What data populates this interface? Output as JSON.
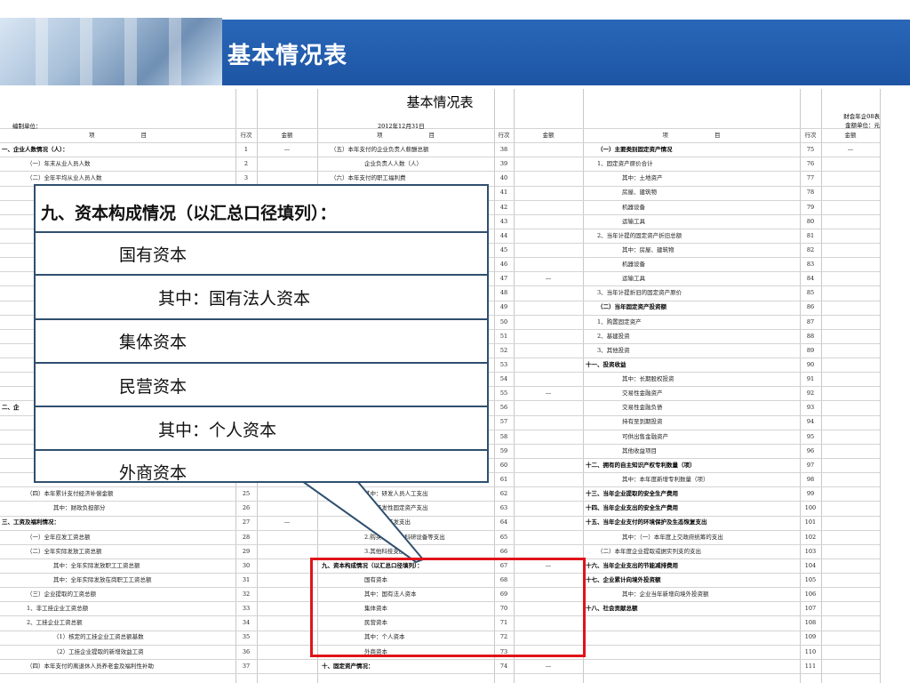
{
  "slide": {
    "title": "基本情况表"
  },
  "sheet": {
    "title": "基本情况表",
    "unit_label": "编制单位：",
    "date": "2012年12月31日",
    "form_no": "财会年企08表",
    "currency": "金额单位：元",
    "headers": [
      "项　　　　　　　　目",
      "行次",
      "金额",
      "项　　　　　　　　目",
      "行次",
      "金额",
      "项　　　　　　　　目",
      "行次",
      "金额"
    ]
  },
  "rows": [
    {
      "a": "一、企业人数情况（人）：",
      "ab": true,
      "an": "1",
      "av": "—",
      "b": "（五）本年支付的企业负责人薪酬总额",
      "bn": "38",
      "bv": "",
      "c": "（一）主要类别固定资产情况",
      "cb": true,
      "cn": "75",
      "cv": "—"
    },
    {
      "a": "（一）年末从业人员人数",
      "an": "2",
      "av": "",
      "b": "企业负责人人数（人）",
      "bn": "39",
      "bv": "",
      "c": "1、固定资产原价合计",
      "cn": "76",
      "cv": ""
    },
    {
      "a": "（二）全年平均从业人员人数",
      "an": "3",
      "av": "",
      "b": "（六）本年支付的职工福利费",
      "bn": "40",
      "bv": "",
      "c": "其中：土地资产",
      "cn": "77",
      "cv": ""
    },
    {
      "a": "（",
      "an": "",
      "av": "",
      "b": "",
      "bn": "41",
      "bv": "",
      "c": "房屋、建筑物",
      "cn": "78",
      "cv": ""
    },
    {
      "a": "",
      "an": "",
      "av": "",
      "b": "",
      "bn": "42",
      "bv": "",
      "c": "机器设备",
      "cn": "79",
      "cv": ""
    },
    {
      "a": "",
      "an": "",
      "av": "",
      "b": "",
      "bn": "43",
      "bv": "",
      "c": "运输工具",
      "cn": "80",
      "cv": ""
    },
    {
      "a": "",
      "an": "",
      "av": "",
      "b": "",
      "bn": "44",
      "bv": "",
      "c": "2、当年计提的固定资产折旧总额",
      "cn": "81",
      "cv": ""
    },
    {
      "a": "（",
      "an": "",
      "av": "",
      "b": "",
      "bn": "45",
      "bv": "",
      "c": "其中：房屋、建筑物",
      "cn": "82",
      "cv": ""
    },
    {
      "a": "（",
      "an": "",
      "av": "",
      "b": "",
      "bn": "46",
      "bv": "",
      "c": "机器设备",
      "cn": "83",
      "cv": ""
    },
    {
      "a": "（",
      "an": "",
      "av": "",
      "b": "",
      "bn": "47",
      "bv": "—",
      "c": "运输工具",
      "cn": "84",
      "cv": ""
    },
    {
      "a": "（",
      "an": "",
      "av": "",
      "b": "",
      "bn": "48",
      "bv": "",
      "c": "3、当年计提折旧的固定资产原价",
      "cn": "85",
      "cv": ""
    },
    {
      "a": "（",
      "an": "",
      "av": "",
      "b": "",
      "bn": "49",
      "bv": "",
      "c": "（二）当年固定资产投资额",
      "cb": true,
      "cn": "86",
      "cv": ""
    },
    {
      "a": "（",
      "an": "",
      "av": "",
      "b": "",
      "bn": "50",
      "bv": "",
      "c": "1、购置固定资产",
      "cn": "87",
      "cv": ""
    },
    {
      "a": "（",
      "an": "",
      "av": "",
      "b": "",
      "bn": "51",
      "bv": "",
      "c": "2、基建投资",
      "cn": "88",
      "cv": ""
    },
    {
      "a": "（",
      "an": "",
      "av": "",
      "b": "",
      "bn": "52",
      "bv": "",
      "c": "3、其他投资",
      "cn": "89",
      "cv": ""
    },
    {
      "a": "（",
      "an": "",
      "av": "",
      "b": "",
      "bn": "53",
      "bv": "",
      "c": "十一、投资收益",
      "cb": true,
      "cn": "90",
      "cv": ""
    },
    {
      "a": "（",
      "an": "",
      "av": "",
      "b": "",
      "bn": "54",
      "bv": "",
      "c": "其中：长期股权投资",
      "cn": "91",
      "cv": ""
    },
    {
      "a": "（",
      "an": "",
      "av": "",
      "b": "",
      "bn": "55",
      "bv": "—",
      "c": "交易性金融资产",
      "cn": "92",
      "cv": ""
    },
    {
      "a": "二、企",
      "ab": true,
      "an": "",
      "av": "",
      "b": "",
      "bn": "56",
      "bv": "",
      "c": "交易性金融负债",
      "cn": "93",
      "cv": ""
    },
    {
      "a": "（",
      "an": "",
      "av": "",
      "b": "",
      "bn": "57",
      "bv": "",
      "c": "持有至到期投资",
      "cn": "94",
      "cv": ""
    },
    {
      "a": "",
      "an": "",
      "av": "",
      "b": "",
      "bn": "58",
      "bv": "",
      "c": "可供出售金融资产",
      "cn": "95",
      "cv": ""
    },
    {
      "a": "（",
      "an": "",
      "av": "",
      "b": "",
      "bn": "59",
      "bv": "",
      "c": "其他收益项目",
      "cn": "96",
      "cv": ""
    },
    {
      "a": "",
      "an": "",
      "av": "",
      "b": "",
      "bn": "60",
      "bv": "",
      "c": "十二、拥有的自主知识产权专利数量（项）",
      "cb": true,
      "cn": "97",
      "cv": ""
    },
    {
      "a": "",
      "an": "",
      "av": "",
      "b": "",
      "bn": "61",
      "bv": "",
      "c": "其中：本年度新增专利数量（项）",
      "cn": "98",
      "cv": ""
    },
    {
      "a": "（四）本年累计支付经济补偿金额",
      "an": "25",
      "av": "",
      "b": "其中：研发人员人工支出",
      "bn": "62",
      "bv": "",
      "c": "十三、当年企业提取的安全生产费用",
      "cb": true,
      "cn": "99",
      "cv": ""
    },
    {
      "a": "其中：财政负担部分",
      "an": "26",
      "av": "",
      "b": "研究开发性固定资产支出",
      "bn": "63",
      "bv": "",
      "c": "十四、当年企业支出的安全生产费用",
      "cb": true,
      "cn": "100",
      "cv": ""
    },
    {
      "a": "三、工资及福利情况：",
      "ab": true,
      "an": "27",
      "av": "—",
      "b": "其他研究开发支出",
      "bn": "64",
      "bv": "",
      "c": "十五、当年企业支付的环境保护及生态恢复支出",
      "cb": true,
      "cn": "101",
      "cv": ""
    },
    {
      "a": "（一）全年应发工资总额",
      "an": "28",
      "av": "",
      "b": "2.购买新技术、科研设备等支出",
      "bn": "65",
      "bv": "",
      "c": "其中：（一）本年度上交政府统筹的支出",
      "cn": "102",
      "cv": ""
    },
    {
      "a": "（二）全年实际发放工资总额",
      "an": "29",
      "av": "",
      "b": "3.其他科技支出",
      "bn": "66",
      "bv": "",
      "c": "（二）本年度企业提取或据实列支的支出",
      "cn": "103",
      "cv": ""
    },
    {
      "a": "其中：全年实际发放职工工资总额",
      "an": "30",
      "av": "",
      "b": "九、资本构成情况（以汇总口径填列）：",
      "bb": true,
      "bn": "67",
      "bv": "—",
      "c": "十六、当年企业支出的节能减排费用",
      "cb": true,
      "cn": "104",
      "cv": ""
    },
    {
      "a": "其中：全年实际发放在岗职工工资总额",
      "an": "31",
      "av": "",
      "b": "国有资本",
      "bn": "68",
      "bv": "",
      "c": "十七、企业累计向境外投资额",
      "cb": true,
      "cn": "105",
      "cv": ""
    },
    {
      "a": "（三）企业提取的工资总额",
      "an": "32",
      "av": "",
      "b": "其中：国有法人资本",
      "bn": "69",
      "bv": "",
      "c": "其中：企业当年新增向境外投资额",
      "cn": "106",
      "cv": ""
    },
    {
      "a": "1、非工挂企业工资总额",
      "an": "33",
      "av": "",
      "b": "集体资本",
      "bn": "70",
      "bv": "",
      "c": "十八、社会贡献总额",
      "cb": true,
      "cn": "107",
      "cv": ""
    },
    {
      "a": "2、工挂企业工资总额",
      "an": "34",
      "av": "",
      "b": "民营资本",
      "bn": "71",
      "bv": "",
      "c": "",
      "cn": "108",
      "cv": ""
    },
    {
      "a": "（1）核定的工挂企业工资总额基数",
      "an": "35",
      "av": "",
      "b": "其中：个人资本",
      "bn": "72",
      "bv": "",
      "c": "",
      "cn": "109",
      "cv": ""
    },
    {
      "a": "（2）工挂企业提取的新增效益工资",
      "an": "36",
      "av": "",
      "b": "外商资本",
      "bn": "73",
      "bv": "",
      "c": "",
      "cn": "110",
      "cv": ""
    },
    {
      "a": "（四）本年支付的离退休人员养老金及福利性补助",
      "an": "37",
      "av": "",
      "b": "十、固定资产情况：",
      "bb": true,
      "bn": "74",
      "bv": "—",
      "c": "",
      "cn": "111",
      "cv": ""
    }
  ],
  "callout": {
    "heading": "九、资本构成情况（以汇总口径填列）：",
    "items": [
      "国有资本",
      "其中：国有法人资本",
      "集体资本",
      "民营资本",
      "其中：个人资本",
      "外商资本"
    ]
  },
  "colors": {
    "banner": "#1d55a4",
    "highlight": "#e0141a",
    "callout_border": "#2f4f6f"
  }
}
